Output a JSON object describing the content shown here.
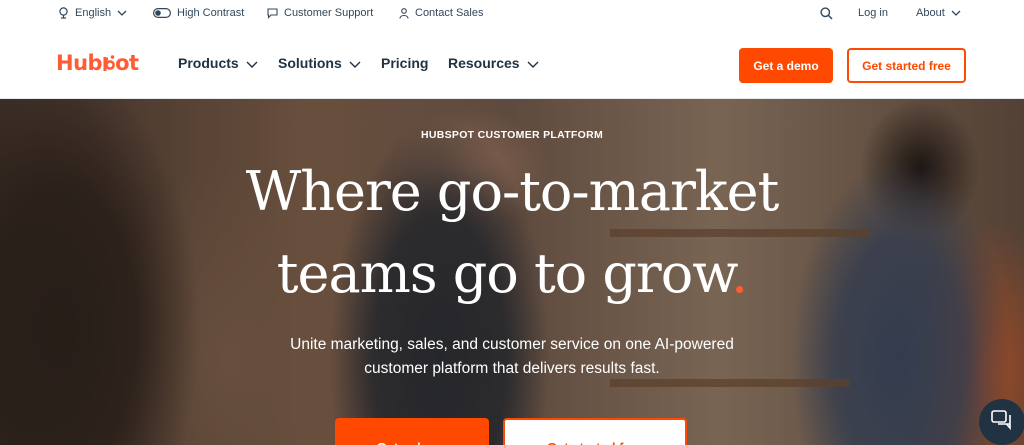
{
  "utility": {
    "language": "English",
    "high_contrast": "High Contrast",
    "customer_support": "Customer Support",
    "contact_sales": "Contact Sales",
    "login": "Log in",
    "about": "About"
  },
  "nav": {
    "logo_left": "Hub",
    "logo_right": "ot",
    "items": [
      "Products",
      "Solutions",
      "Pricing",
      "Resources"
    ],
    "get_demo": "Get a demo",
    "get_started": "Get started free"
  },
  "hero": {
    "eyebrow": "HUBSPOT CUSTOMER PLATFORM",
    "headline_line1": "Where go-to-market",
    "headline_line2": "teams go to grow",
    "headline_dot": ".",
    "subcopy_line1": "Unite marketing, sales, and customer service on one AI-powered",
    "subcopy_line2": "customer platform that delivers results fast.",
    "primary_cta": "Get a demo",
    "secondary_cta": "Get started free"
  },
  "colors": {
    "accent": "#ff4800",
    "brand": "#ff5c35",
    "text_dark": "#213343"
  },
  "icons": [
    "globe-icon",
    "toggle-icon",
    "chat-bubble-icon",
    "person-icon",
    "search-icon",
    "chevron-down-icon",
    "chat-widget-icon"
  ]
}
